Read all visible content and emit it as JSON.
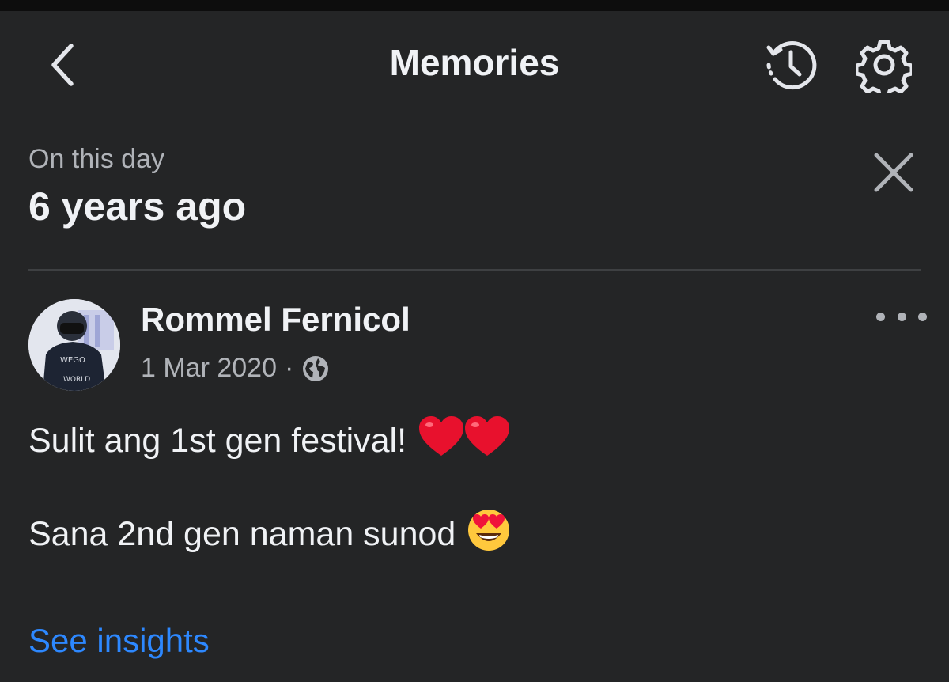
{
  "header": {
    "title": "Memories",
    "icons": [
      "back-chevron-icon",
      "history-icon",
      "gear-icon"
    ]
  },
  "memory": {
    "label": "On this day",
    "years_ago": "6 years ago"
  },
  "post": {
    "author": "Rommel Fernicol",
    "date": "1 Mar 2020",
    "separator": "·",
    "privacy_icon": "globe-icon",
    "line1": "Sulit ang 1st gen festival!",
    "line1_emoji": [
      "red-heart-emoji",
      "red-heart-emoji"
    ],
    "line2": "Sana 2nd gen naman sunod",
    "line2_emoji": [
      "heart-eyes-emoji"
    ]
  },
  "actions": {
    "see_insights": "See insights"
  },
  "colors": {
    "background": "#242526",
    "link": "#2d88ff",
    "secondary_text": "#b0b3b8"
  }
}
